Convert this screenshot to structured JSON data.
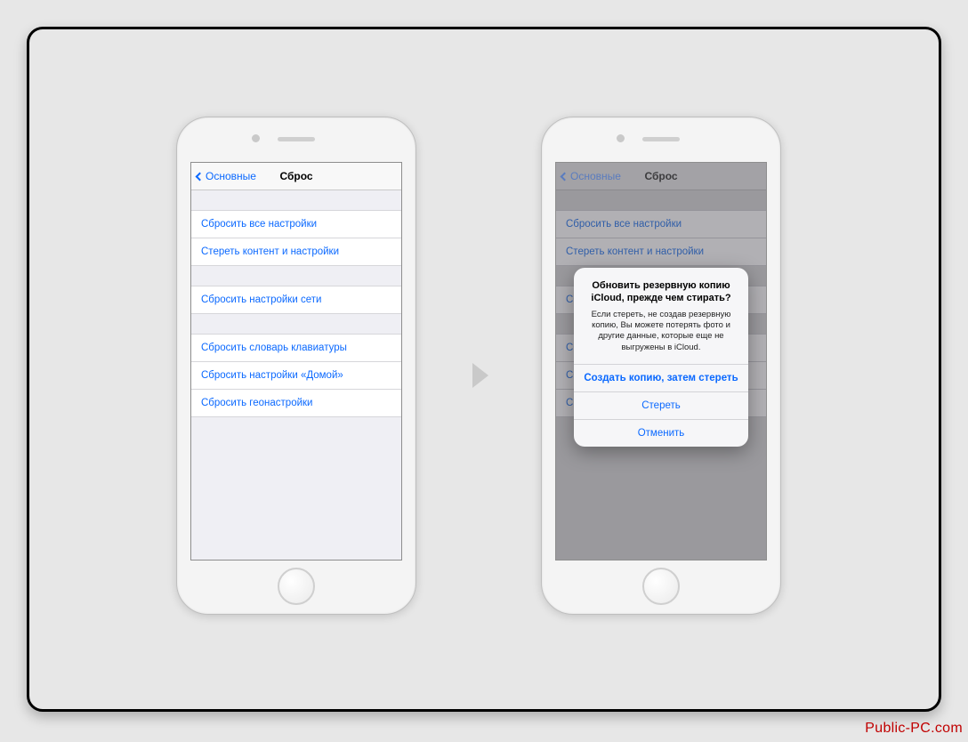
{
  "watermark": "Public-PC.com",
  "nav": {
    "back": "Основные",
    "title": "Сброс"
  },
  "rows": {
    "reset_all": "Сбросить все настройки",
    "erase_content": "Стереть контент и настройки",
    "reset_network": "Сбросить настройки сети",
    "reset_keyboard": "Сбросить словарь клавиатуры",
    "reset_home": "Сбросить настройки «Домой»",
    "reset_location": "Сбросить геонастройки"
  },
  "alert": {
    "title": "Обновить резервную копию iCloud, прежде чем стирать?",
    "message": "Если стереть, не создав резервную копию, Вы можете потерять фото и другие данные, которые еще не выгружены в iCloud.",
    "btn_backup": "Создать копию, затем стереть",
    "btn_erase": "Стереть",
    "btn_cancel": "Отменить"
  }
}
